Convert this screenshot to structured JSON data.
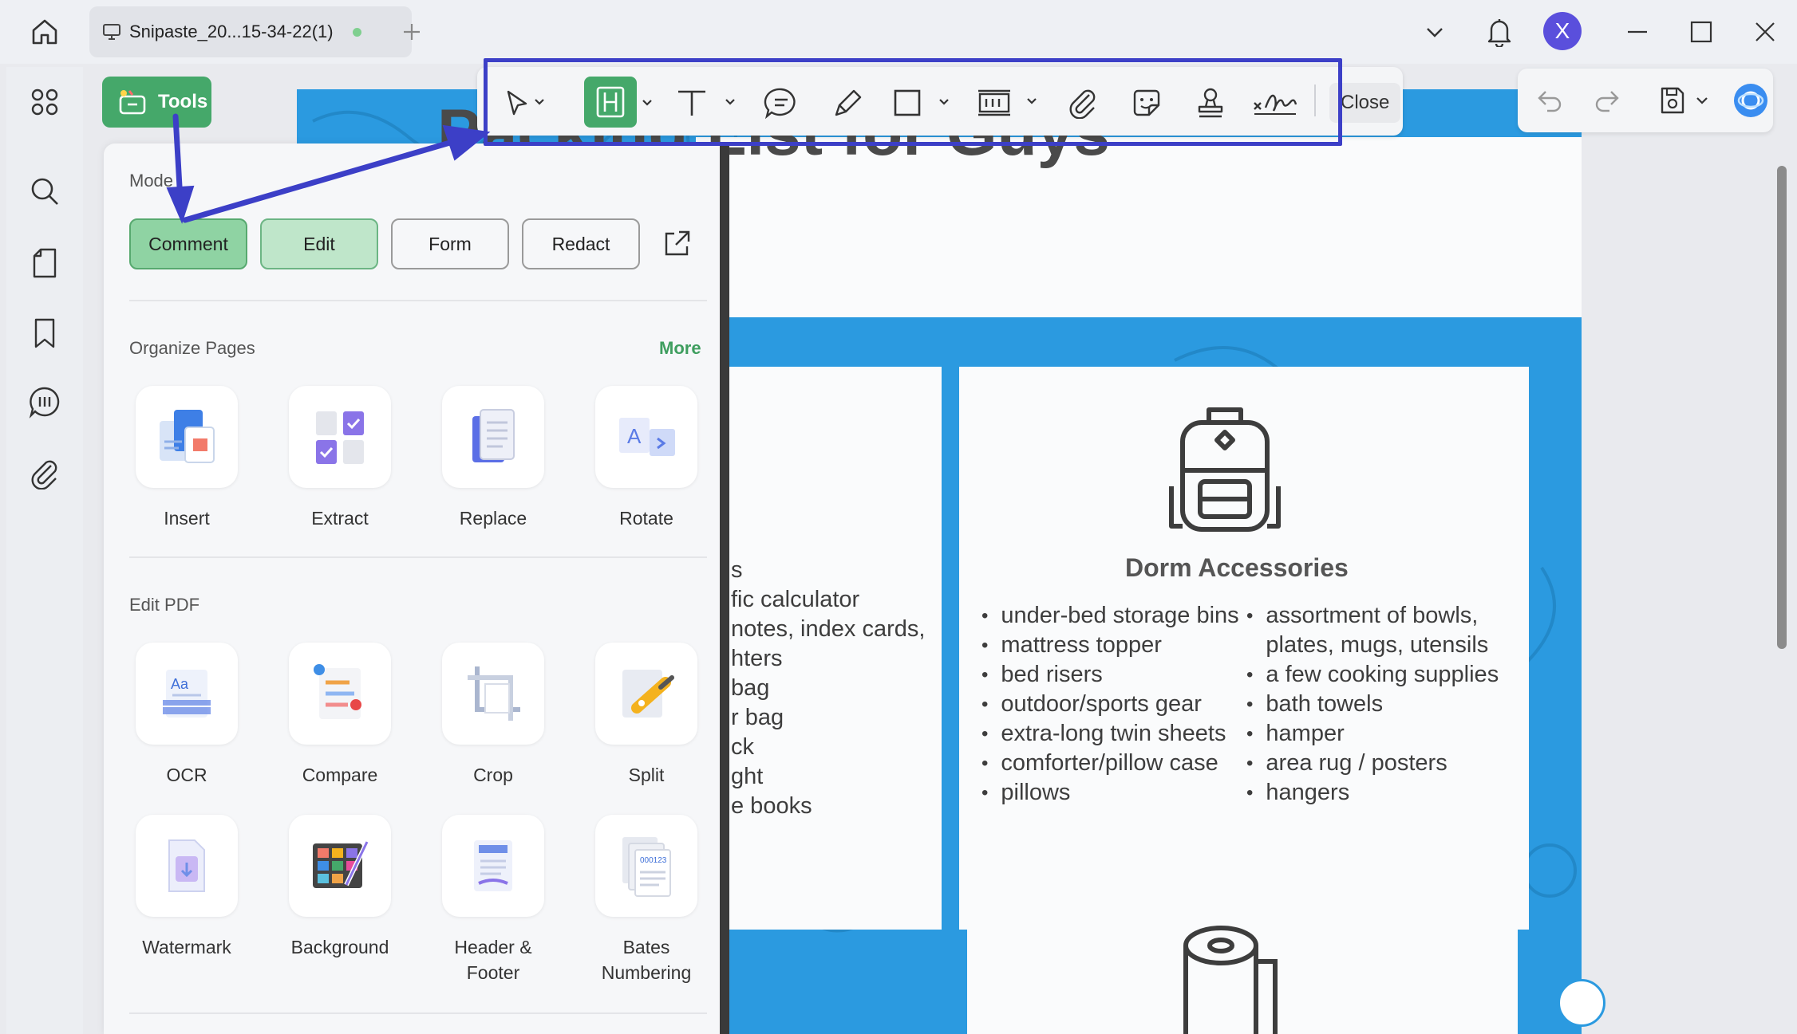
{
  "titlebar": {
    "tab_title": "Snipaste_20...15-34-22(1)",
    "avatar_letter": "X"
  },
  "annotation_toolbar": {
    "close_label": "Close",
    "tools": [
      "select-tool",
      "highlight-tool",
      "text-tool",
      "comment-tool",
      "pencil-tool",
      "shape-tool",
      "textbox-tool",
      "attachment-tool",
      "sticker-tool",
      "stamp-tool",
      "signature-tool"
    ]
  },
  "tools_panel": {
    "tools_button_label": "Tools",
    "mode_label": "Mode",
    "modes": [
      "Comment",
      "Edit",
      "Form",
      "Redact"
    ],
    "organize": {
      "title": "Organize Pages",
      "more": "More",
      "items": [
        "Insert",
        "Extract",
        "Replace",
        "Rotate"
      ]
    },
    "edit_pdf": {
      "title": "Edit PDF",
      "items": [
        "OCR",
        "Compare",
        "Crop",
        "Split",
        "Watermark",
        "Background",
        "Header & Footer",
        "Bates Numbering"
      ]
    }
  },
  "document": {
    "title": "Packing List for Guys",
    "left_card_fragments": [
      "s",
      "fic calculator",
      "notes, index cards,",
      "hters",
      "bag",
      "r bag",
      "ck",
      "ght",
      "e books"
    ],
    "dorm": {
      "heading": "Dorm Accessories",
      "col1": [
        "under-bed storage bins",
        "mattress topper",
        "bed risers",
        "outdoor/sports gear",
        "extra-long twin sheets",
        "comforter/pillow case",
        "pillows"
      ],
      "col2": [
        "assortment of bowls,",
        "plates, mugs, utensils",
        "a few cooking supplies",
        "bath towels",
        "hamper",
        "area rug / posters",
        "hangers"
      ]
    }
  },
  "colors": {
    "accent_green": "#45a86a",
    "annotation_blue": "#3c3fc7",
    "page_blue": "#2b9ae0"
  }
}
